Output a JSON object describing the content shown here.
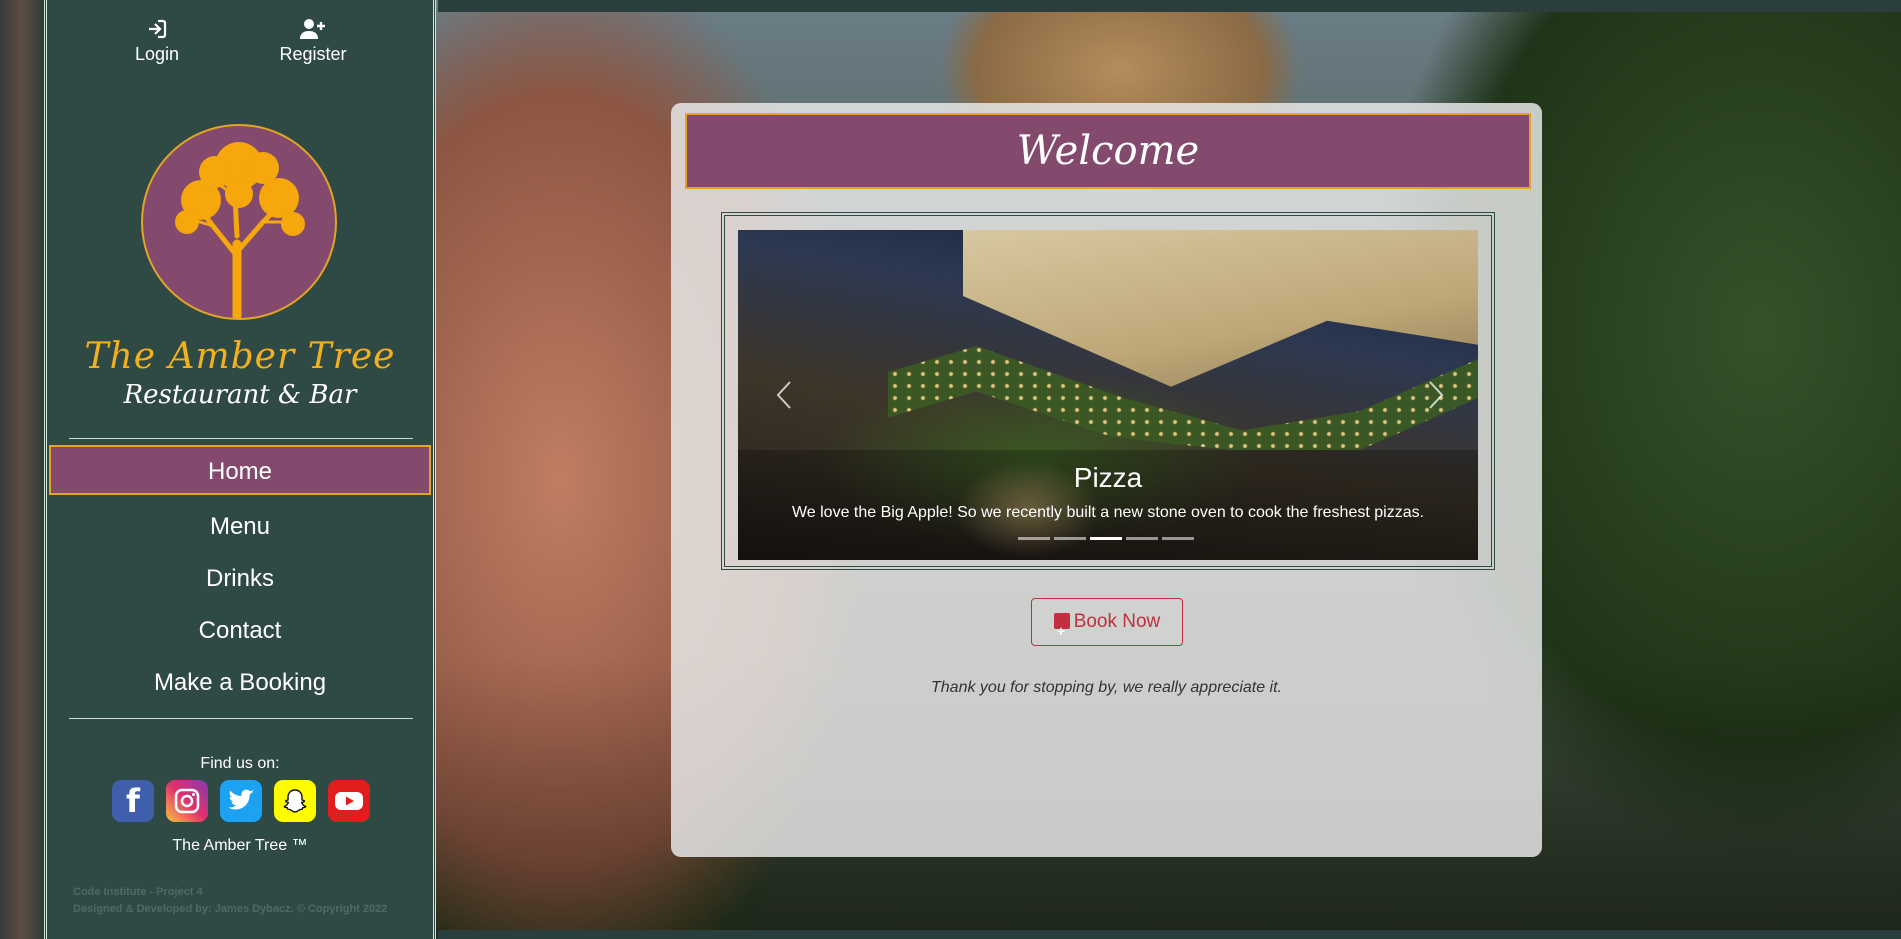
{
  "auth": {
    "login_label": "Login",
    "register_label": "Register"
  },
  "brand": {
    "name": "The Amber Tree",
    "subtitle": "Restaurant & Bar"
  },
  "nav": {
    "items": [
      {
        "label": "Home",
        "active": true
      },
      {
        "label": "Menu",
        "active": false
      },
      {
        "label": "Drinks",
        "active": false
      },
      {
        "label": "Contact",
        "active": false
      },
      {
        "label": "Make a Booking",
        "active": false
      }
    ]
  },
  "social": {
    "heading": "Find us on:",
    "icons": [
      "facebook-icon",
      "instagram-icon",
      "twitter-icon",
      "snapchat-icon",
      "youtube-icon"
    ],
    "trademark": "The Amber Tree ™"
  },
  "footer": {
    "line1": "Code Institute - Project 4",
    "line2": "Designed & Developed by: James Dybacz. © Copyright 2022"
  },
  "main": {
    "welcome_title": "Welcome",
    "slide": {
      "title": "Pizza",
      "text": "We love the Big Apple! So we recently built a new stone oven to cook the freshest pizzas.",
      "indicator_count": 5,
      "active_indicator": 2
    },
    "book_label": "Book Now",
    "thanks_text": "Thank you for stopping by, we really appreciate it."
  },
  "colors": {
    "sidebar": "#2f4a44",
    "accent_purple": "#834a6e",
    "accent_amber": "#e3a325",
    "book_red": "#c0303f"
  }
}
